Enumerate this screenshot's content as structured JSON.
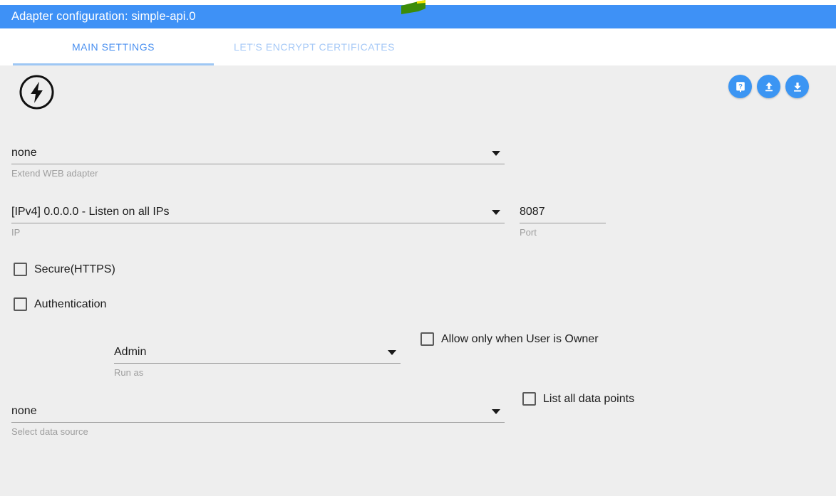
{
  "window": {
    "title": "Adapter configuration: simple-api.0"
  },
  "tabs": [
    {
      "label": "MAIN SETTINGS",
      "active": true
    },
    {
      "label": "LET'S ENCRYPT CERTIFICATES",
      "active": false
    }
  ],
  "toolbar": {
    "help_icon": "help-question-icon",
    "upload_icon": "upload-icon",
    "download_icon": "download-icon"
  },
  "branding": {
    "logo_icon": "lightning-bolt-circle-icon"
  },
  "form": {
    "extend_web_adapter": {
      "value": "none",
      "hint": "Extend WEB adapter"
    },
    "ip": {
      "value": "[IPv4] 0.0.0.0 - Listen on all IPs",
      "hint": "IP"
    },
    "port": {
      "value": "8087",
      "hint": "Port"
    },
    "secure_https": {
      "label": "Secure(HTTPS)",
      "checked": false
    },
    "authentication": {
      "label": "Authentication",
      "checked": false
    },
    "run_as": {
      "value": "Admin",
      "hint": "Run as"
    },
    "allow_only_owner": {
      "label": "Allow only when User is Owner",
      "checked": false
    },
    "data_source": {
      "value": "none",
      "hint": "Select data source"
    },
    "list_all_data_points": {
      "label": "List all data points",
      "checked": false
    }
  },
  "colors": {
    "header_blue": "#3e91f6",
    "tab_active": "#4a90f0",
    "tab_inactive": "#a6c9f7",
    "button_blue": "#3b95f3",
    "body_bg": "#eeeeee",
    "decoration_green": "#3c8c09",
    "decoration_yellow": "#f2e500"
  }
}
